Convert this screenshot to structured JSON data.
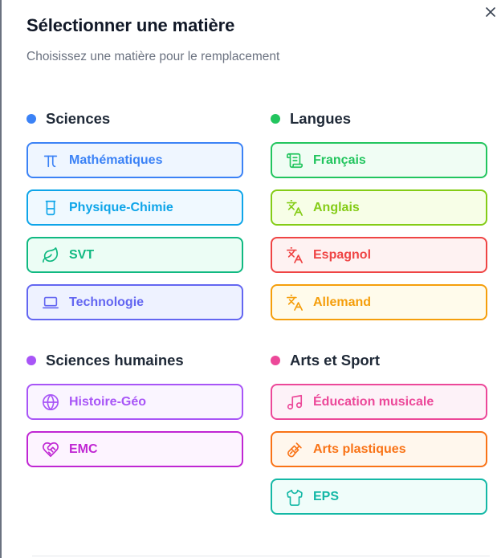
{
  "dialog": {
    "title": "Sélectionner une matière",
    "subtitle": "Choisissez une matière pour le remplacement"
  },
  "sections": {
    "sciences": {
      "label": "Sciences",
      "color": "#3b82f6",
      "items": [
        {
          "label": "Mathématiques",
          "icon": "pi-icon",
          "color": "#3b82f6"
        },
        {
          "label": "Physique-Chimie",
          "icon": "beaker-icon",
          "color": "#0ea5e9"
        },
        {
          "label": "SVT",
          "icon": "leaf-icon",
          "color": "#10b981"
        },
        {
          "label": "Technologie",
          "icon": "laptop-icon",
          "color": "#6366f1"
        }
      ]
    },
    "langues": {
      "label": "Langues",
      "color": "#22c55e",
      "items": [
        {
          "label": "Français",
          "icon": "scroll-icon",
          "color": "#22c55e"
        },
        {
          "label": "Anglais",
          "icon": "translate-icon",
          "color": "#84cc16"
        },
        {
          "label": "Espagnol",
          "icon": "translate-icon",
          "color": "#ef4444"
        },
        {
          "label": "Allemand",
          "icon": "translate-icon",
          "color": "#f59e0b"
        }
      ]
    },
    "humaines": {
      "label": "Sciences humaines",
      "color": "#a855f7",
      "items": [
        {
          "label": "Histoire-Géo",
          "icon": "globe-icon",
          "color": "#a855f7"
        },
        {
          "label": "EMC",
          "icon": "heart-handshake-icon",
          "color": "#c026d3"
        }
      ]
    },
    "arts": {
      "label": "Arts et Sport",
      "color": "#ec4899",
      "items": [
        {
          "label": "Éducation musicale",
          "icon": "music-icon",
          "color": "#ec4899"
        },
        {
          "label": "Arts plastiques",
          "icon": "brush-icon",
          "color": "#f97316"
        },
        {
          "label": "EPS",
          "icon": "shirt-icon",
          "color": "#14b8a6"
        }
      ]
    }
  }
}
